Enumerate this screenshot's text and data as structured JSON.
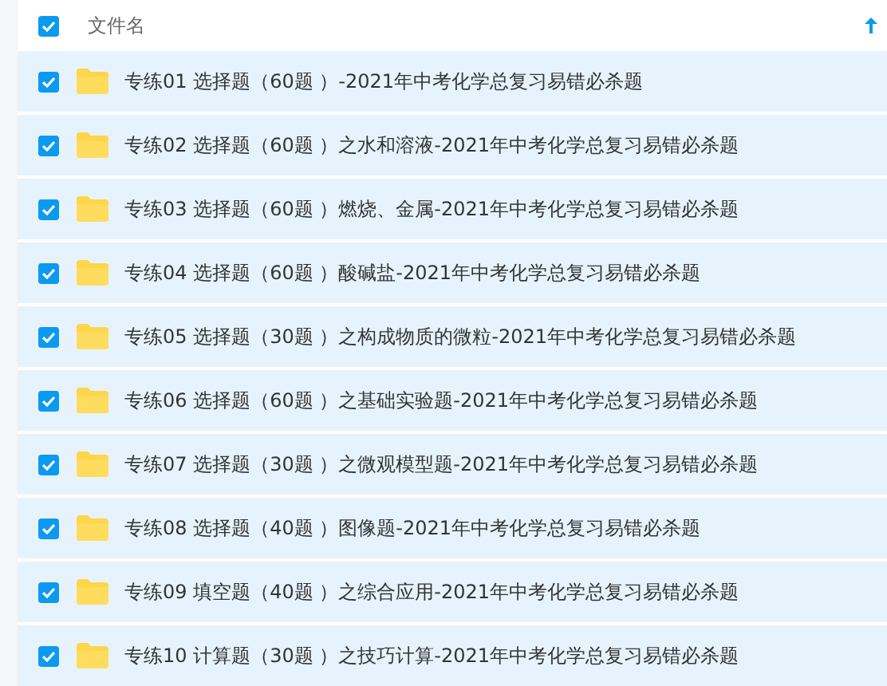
{
  "header": {
    "label": "文件名",
    "checked": true
  },
  "rows": [
    {
      "name": "专练01 选择题（60题 ）-2021年中考化学总复习易错必杀题",
      "checked": true
    },
    {
      "name": "专练02 选择题（60题 ）之水和溶液-2021年中考化学总复习易错必杀题",
      "checked": true
    },
    {
      "name": "专练03 选择题（60题 ）燃烧、金属-2021年中考化学总复习易错必杀题",
      "checked": true
    },
    {
      "name": "专练04 选择题（60题 ）酸碱盐-2021年中考化学总复习易错必杀题",
      "checked": true
    },
    {
      "name": "专练05 选择题（30题 ）之构成物质的微粒-2021年中考化学总复习易错必杀题",
      "checked": true
    },
    {
      "name": "专练06 选择题（60题 ）之基础实验题-2021年中考化学总复习易错必杀题",
      "checked": true
    },
    {
      "name": "专练07 选择题（30题 ）之微观模型题-2021年中考化学总复习易错必杀题",
      "checked": true
    },
    {
      "name": "专练08 选择题（40题 ）图像题-2021年中考化学总复习易错必杀题",
      "checked": true
    },
    {
      "name": "专练09 填空题（40题 ）之综合应用-2021年中考化学总复习易错必杀题",
      "checked": true
    },
    {
      "name": "专练10 计算题（30题 ）之技巧计算-2021年中考化学总复习易错必杀题",
      "checked": true
    }
  ]
}
